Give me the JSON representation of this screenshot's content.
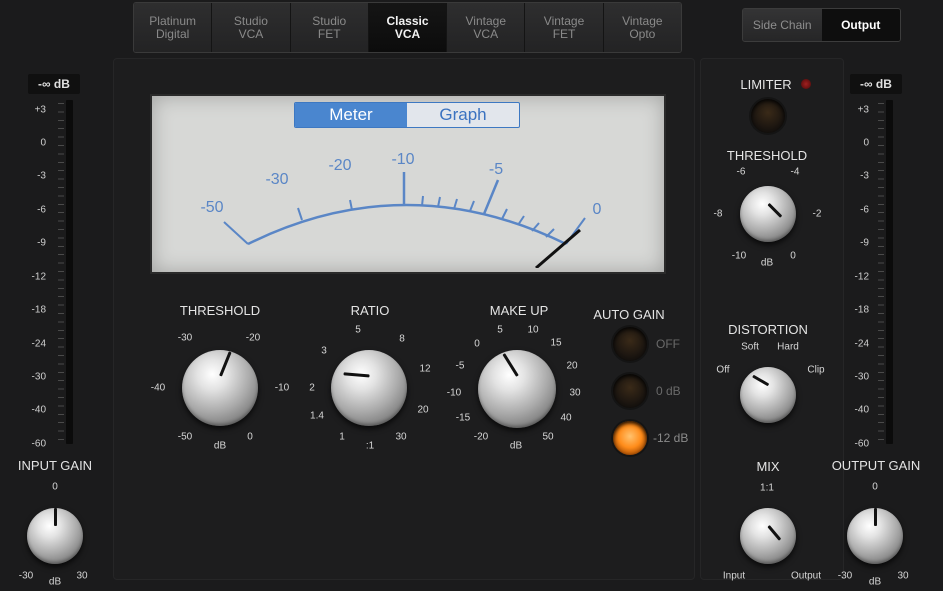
{
  "models": [
    "Platinum\nDigital",
    "Studio\nVCA",
    "Studio\nFET",
    "Classic\nVCA",
    "Vintage\nVCA",
    "Vintage\nFET",
    "Vintage\nOpto"
  ],
  "model_tabs": [
    {
      "line1": "Platinum",
      "line2": "Digital"
    },
    {
      "line1": "Studio",
      "line2": "VCA"
    },
    {
      "line1": "Studio",
      "line2": "FET"
    },
    {
      "line1": "Classic",
      "line2": "VCA"
    },
    {
      "line1": "Vintage",
      "line2": "VCA"
    },
    {
      "line1": "Vintage",
      "line2": "FET"
    },
    {
      "line1": "Vintage",
      "line2": "Opto"
    }
  ],
  "selected_model": "Classic VCA",
  "view_tabs": {
    "side_chain": "Side Chain",
    "output": "Output",
    "selected": "Output"
  },
  "input_meter": {
    "peak": "-∞ dB",
    "scale": [
      "+3",
      "0",
      "-3",
      "-6",
      "-9",
      "-12",
      "-18",
      "-24",
      "-30",
      "-40",
      "-60"
    ]
  },
  "output_meter": {
    "peak": "-∞ dB",
    "scale": [
      "+3",
      "0",
      "-3",
      "-6",
      "-9",
      "-12",
      "-18",
      "-24",
      "-30",
      "-40",
      "-60"
    ]
  },
  "vu": {
    "mode_meter": "Meter",
    "mode_graph": "Graph",
    "selected_mode": "Meter",
    "scale": [
      "-50",
      "-30",
      "-20",
      "-10",
      "-5",
      "0"
    ],
    "accent": "#5a86c6"
  },
  "threshold": {
    "title": "THRESHOLD",
    "labels": [
      "-50",
      "-40",
      "-30",
      "-20",
      "-10",
      "0"
    ],
    "unit": "dB"
  },
  "ratio": {
    "title": "RATIO",
    "labels": [
      "1",
      "1.4",
      "2",
      "3",
      "5",
      "8",
      "12",
      "20",
      "30"
    ],
    "unit": ":1"
  },
  "makeup": {
    "title": "MAKE UP",
    "labels": [
      "-20",
      "-15",
      "-10",
      "-5",
      "0",
      "5",
      "10",
      "15",
      "20",
      "30",
      "40",
      "50"
    ],
    "unit": "dB"
  },
  "auto_gain": {
    "title": "AUTO GAIN",
    "options": [
      "OFF",
      "0 dB",
      "-12 dB"
    ],
    "selected": "-12 dB",
    "active_color": "#ff9020"
  },
  "input_gain": {
    "title": "INPUT GAIN",
    "top": "0",
    "min": "-30",
    "max": "30",
    "unit": "dB"
  },
  "limiter": {
    "title": "LIMITER",
    "threshold_title": "THRESHOLD",
    "labels": [
      "-10",
      "-8",
      "-6",
      "-4",
      "-2",
      "0"
    ],
    "unit": "dB"
  },
  "distortion": {
    "title": "DISTORTION",
    "labels": [
      "Off",
      "Soft",
      "Hard",
      "Clip"
    ]
  },
  "mix": {
    "title": "MIX",
    "top": "1:1",
    "left": "Input",
    "right": "Output"
  },
  "output_gain": {
    "title": "OUTPUT GAIN",
    "top": "0",
    "min": "-30",
    "max": "30",
    "unit": "dB"
  }
}
